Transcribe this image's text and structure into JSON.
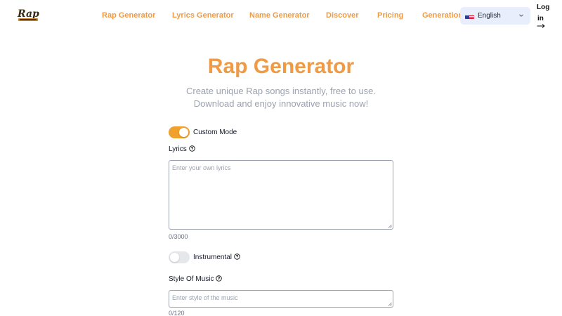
{
  "header": {
    "logo_text": "Rap",
    "nav": [
      {
        "label": "Rap Generator"
      },
      {
        "label": "Lyrics Generator"
      },
      {
        "label": "Name Generator"
      },
      {
        "label": "Discover"
      },
      {
        "label": "Pricing"
      },
      {
        "label": "Generation"
      }
    ],
    "language": {
      "label": "English",
      "icon": "us-flag-icon"
    },
    "login_line1": "Log",
    "login_line2": "in",
    "login_icon": "arrow-right-icon"
  },
  "hero": {
    "title": "Rap Generator",
    "subtitle_line1": "Create unique Rap songs instantly, free to use.",
    "subtitle_line2": "Download and enjoy innovative music now!"
  },
  "form": {
    "custom_mode": {
      "label": "Custom Mode",
      "enabled": true
    },
    "lyrics": {
      "label": "Lyrics",
      "placeholder": "Enter your own lyrics",
      "value": "",
      "counter": "0/3000"
    },
    "instrumental": {
      "label": "Instrumental",
      "enabled": false
    },
    "style": {
      "label": "Style Of Music",
      "placeholder": "Enter style of the music",
      "value": "",
      "counter": "0/120"
    }
  },
  "colors": {
    "accent": "#ef9a45",
    "toggle_on": "#f0a02c",
    "toggle_off": "#e5e7eb"
  }
}
